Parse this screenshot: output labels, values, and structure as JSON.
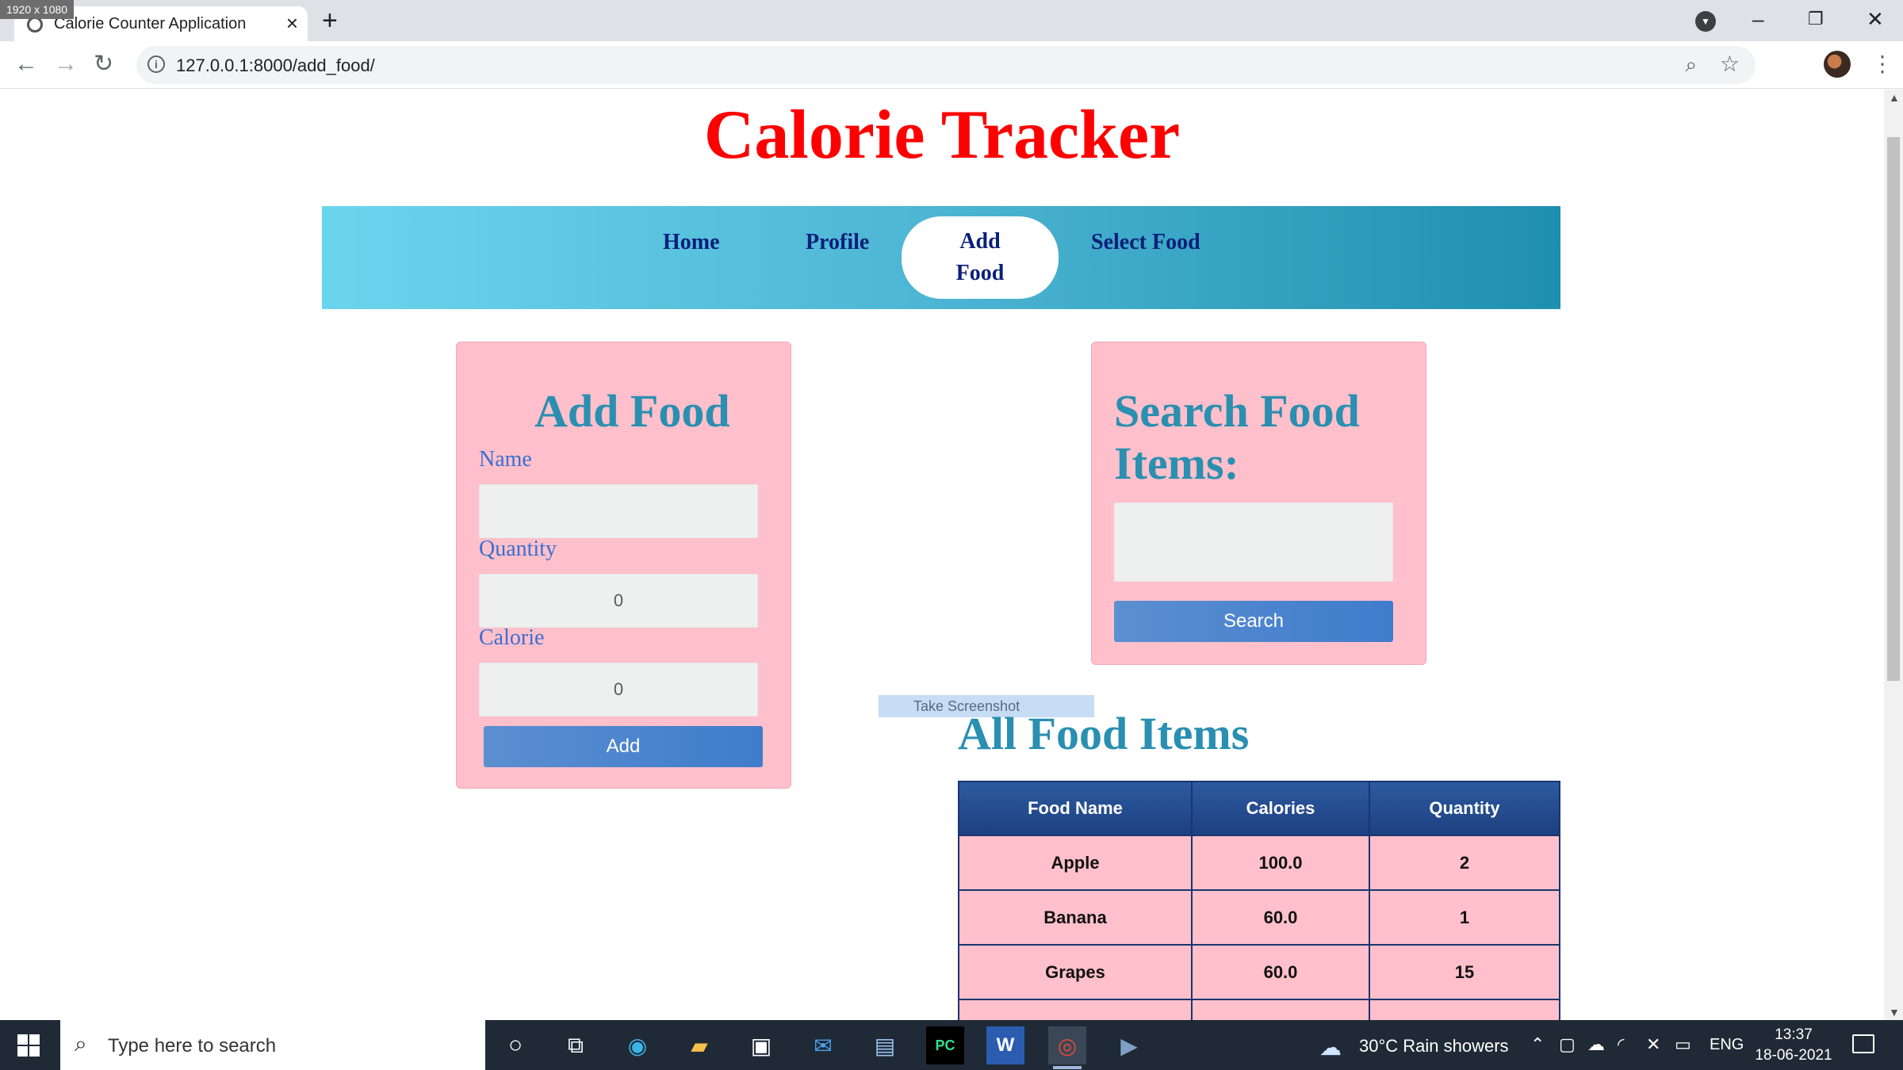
{
  "screen_badge": "1920 x 1080",
  "browser": {
    "tab_title": "Calorie Counter Application",
    "url": "127.0.0.1:8000/add_food/"
  },
  "page": {
    "title": "Calorie Tracker",
    "nav": {
      "home": "Home",
      "profile": "Profile",
      "add_food_line1": "Add",
      "add_food_line2": "Food",
      "select_food": "Select Food"
    },
    "add_food": {
      "heading": "Add Food",
      "name_label": "Name",
      "name_value": "",
      "quantity_label": "Quantity",
      "quantity_value": "0",
      "calorie_label": "Calorie",
      "calorie_value": "0",
      "submit_label": "Add"
    },
    "search_food": {
      "heading_line1": "Search Food",
      "heading_line2": "Items:",
      "query_value": "",
      "submit_label": "Search"
    },
    "screenshot_chip": "Take Screenshot",
    "all_food": {
      "heading": "All Food Items",
      "columns": [
        "Food Name",
        "Calories",
        "Quantity"
      ],
      "rows": [
        [
          "Apple",
          "100.0",
          "2"
        ],
        [
          "Banana",
          "60.0",
          "1"
        ],
        [
          "Grapes",
          "60.0",
          "15"
        ],
        [
          "",
          "",
          ""
        ]
      ]
    }
  },
  "taskbar": {
    "search_placeholder": "Type here to search",
    "weather": "30°C  Rain showers",
    "language": "ENG",
    "time": "13:37",
    "date": "18-06-2021"
  },
  "colors": {
    "title_red": "#ff0000",
    "card_pink": "#ffc0cb",
    "heading_teal": "#2a8fb0",
    "nav_text": "#0a1f7a",
    "button_blue": "#4a85cc",
    "table_header": "#1e4080"
  }
}
